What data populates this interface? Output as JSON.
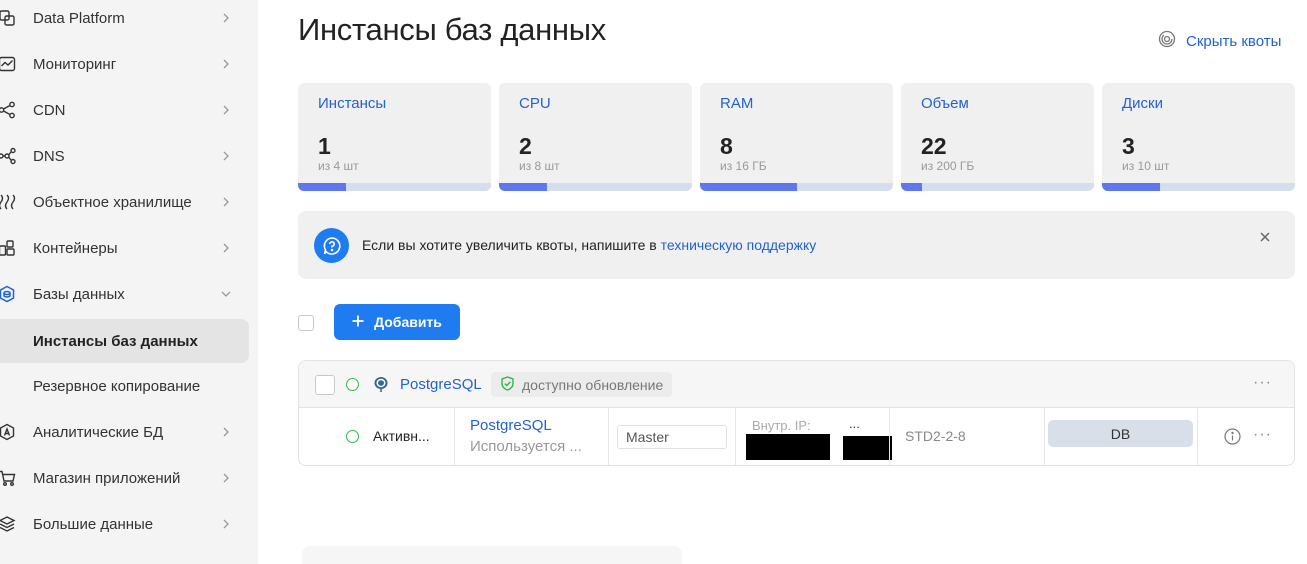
{
  "sidebar": {
    "items": [
      {
        "label": "Data Platform",
        "icon": "data-platform-icon"
      },
      {
        "label": "Мониторинг",
        "icon": "monitoring-icon"
      },
      {
        "label": "CDN",
        "icon": "cdn-icon"
      },
      {
        "label": "DNS",
        "icon": "dns-icon"
      },
      {
        "label": "Объектное хранилище",
        "icon": "object-storage-icon"
      },
      {
        "label": "Контейнеры",
        "icon": "containers-icon"
      },
      {
        "label": "Базы данных",
        "icon": "databases-icon"
      },
      {
        "label": "Инстансы баз данных"
      },
      {
        "label": "Резервное копирование"
      },
      {
        "label": "Аналитические БД",
        "icon": "analytics-db-icon"
      },
      {
        "label": "Магазин приложений",
        "icon": "app-store-icon"
      },
      {
        "label": "Большие данные",
        "icon": "big-data-icon"
      }
    ]
  },
  "page": {
    "title": "Инстансы баз данных",
    "hide_quotas": "Скрыть квоты"
  },
  "quotas": [
    {
      "label": "Инстансы",
      "value": "1",
      "sub": "из 4 шт",
      "fraction": 0.25
    },
    {
      "label": "CPU",
      "value": "2",
      "sub": "из 8 шт",
      "fraction": 0.25
    },
    {
      "label": "RAM",
      "value": "8",
      "sub": "из 16 ГБ",
      "fraction": 0.5
    },
    {
      "label": "Объем",
      "value": "22",
      "sub": "из 200 ГБ",
      "fraction": 0.11
    },
    {
      "label": "Диски",
      "value": "3",
      "sub": "из 10 шт",
      "fraction": 0.3
    }
  ],
  "info": {
    "text": "Если вы хотите увеличить квоты, напишите в ",
    "link": "техническую поддержку"
  },
  "toolbar": {
    "add_label": "Добавить"
  },
  "group": {
    "name": "PostgreSQL",
    "update_badge": "доступно обновление"
  },
  "instance": {
    "status": "Активн...",
    "engine": "PostgreSQL",
    "usage": "Используется ...",
    "role": "Master",
    "ip_label": "Внутр. IP:",
    "ip_more": "...",
    "flavor": "STD2-2-8",
    "type": "DB"
  },
  "colors": {
    "accent": "#1e7bf0",
    "link": "#2462cc",
    "progress_fill": "#5f77ee",
    "progress_track": "#d4deef",
    "status_ok": "#34b54a"
  }
}
